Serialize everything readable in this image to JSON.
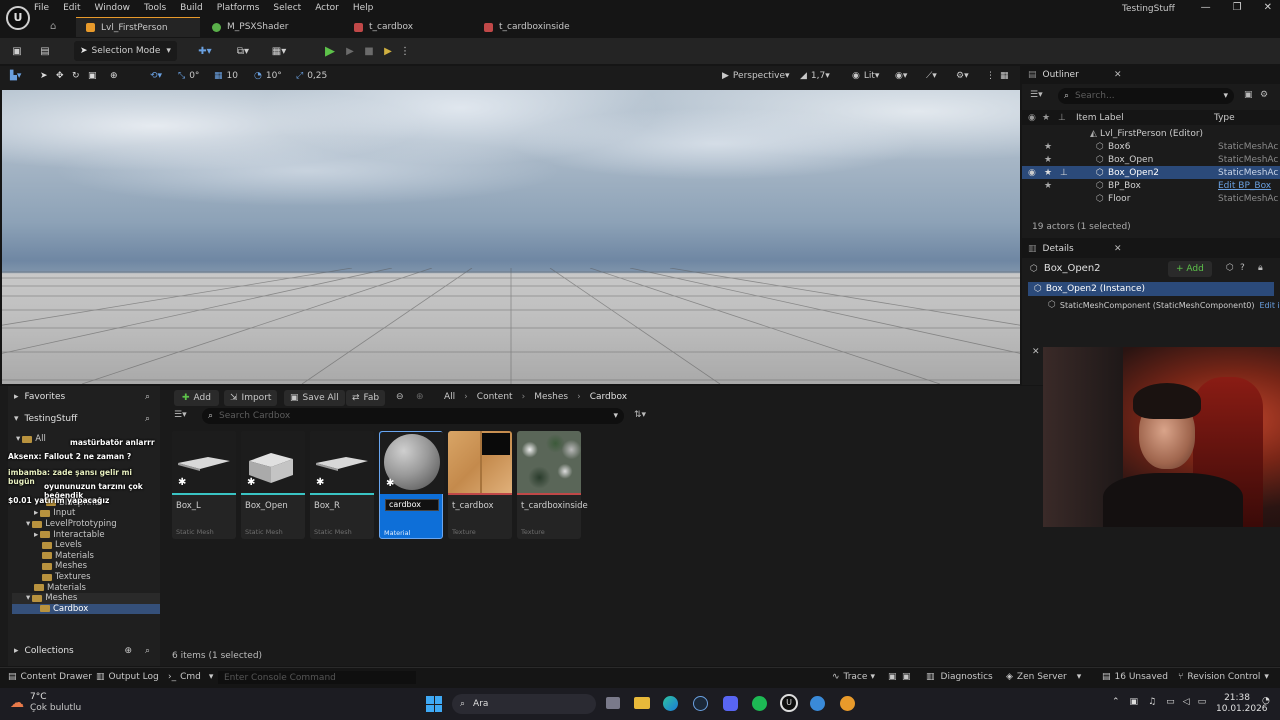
{
  "app": {
    "menu": [
      "File",
      "Edit",
      "Window",
      "Tools",
      "Build",
      "Platforms",
      "Select",
      "Actor",
      "Help"
    ],
    "project_name": "TestingStuff",
    "tabs": [
      {
        "label": "Lvl_FirstPerson",
        "color": "#e89a2b"
      },
      {
        "label": "M_PSXShader",
        "color": "#5ab04a"
      },
      {
        "label": "t_cardbox",
        "color": "#c04848"
      },
      {
        "label": "t_cardboxinside",
        "color": "#c04848"
      }
    ]
  },
  "toolbar": {
    "selection_mode": "Selection Mode"
  },
  "viewport_toolbar": {
    "rot_snap": "0°",
    "grid_snap": "10",
    "angle_snap": "10°",
    "scale_snap": "0,25",
    "perspective": "Perspective",
    "fov": "1,7",
    "lit": "Lit"
  },
  "outliner": {
    "title": "Outliner",
    "search_placeholder": "Search...",
    "col_label": "Item Label",
    "col_type": "Type",
    "root": "Lvl_FirstPerson (Editor)",
    "rows": [
      {
        "name": "Box6",
        "type": "StaticMeshAc"
      },
      {
        "name": "Box_Open",
        "type": "StaticMeshAc"
      },
      {
        "name": "Box_Open2",
        "type": "StaticMeshAc"
      },
      {
        "name": "BP_Box",
        "type": "Edit BP_Box"
      },
      {
        "name": "Floor",
        "type": "StaticMeshAc"
      }
    ],
    "count": "19 actors (1 selected)"
  },
  "details": {
    "title": "Details",
    "object": "Box_Open2",
    "add_label": "+ Add",
    "instance": "Box_Open2 (Instance)",
    "component": "StaticMeshComponent (StaticMeshComponent0)",
    "component_edit": "Edit i"
  },
  "content_browser": {
    "favorites": "Favorites",
    "project": "TestingStuff",
    "add": "Add",
    "import": "Import",
    "save_all": "Save All",
    "fab": "Fab",
    "breadcrumb": [
      "All",
      "Content",
      "Meshes",
      "Cardbox"
    ],
    "search_placeholder": "Search Cardbox",
    "tree": [
      "All",
      "Blueprints",
      "Input",
      "LevelPrototyping",
      "Interactable",
      "Levels",
      "Materials",
      "Meshes",
      "Textures",
      "Materials",
      "Meshes",
      "Cardbox"
    ],
    "assets": [
      {
        "name": "Box_L",
        "type": "Static Mesh"
      },
      {
        "name": "Box_Open",
        "type": "Static Mesh"
      },
      {
        "name": "Box_R",
        "type": "Static Mesh"
      },
      {
        "name": "cardbox",
        "type": "Material"
      },
      {
        "name": "t_cardbox",
        "type": "Texture"
      },
      {
        "name": "t_cardboxinside",
        "type": "Texture"
      }
    ],
    "collections": "Collections",
    "item_count": "6 items (1 selected)"
  },
  "chat_overlay": [
    "mastürbatör anlarrr",
    "Aksenx: Fallout 2 ne zaman ?",
    "imbamba: zade şansı gelir mi bugün",
    "oyununuzun tarzını çok beğendik",
    "$0.01 yatırım yapacağız"
  ],
  "statusbar": {
    "content_drawer": "Content Drawer",
    "output_log": "Output Log",
    "cmd": "Cmd",
    "console_placeholder": "Enter Console Command",
    "trace": "Trace",
    "diagnostics": "Diagnostics",
    "zen": "Zen Server",
    "unsaved": "16 Unsaved",
    "revision": "Revision Control"
  },
  "taskbar": {
    "weather_temp": "7°C",
    "weather_desc": "Çok bulutlu",
    "search": "Ara",
    "time": "21:38",
    "date": "10.01.2026"
  }
}
